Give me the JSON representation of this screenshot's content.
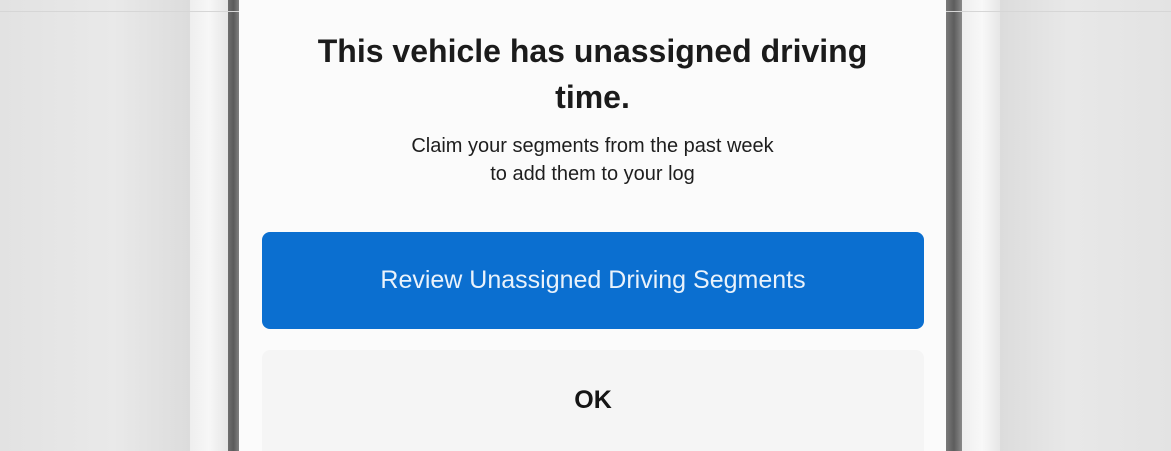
{
  "dialog": {
    "title_lines": [
      "This vehicle has unassigned driving",
      "time."
    ],
    "subtitle_lines": [
      "Claim your segments from the past week",
      "to add them to your log"
    ],
    "primary_button_label": "Review Unassigned Driving Segments",
    "secondary_button_label": "OK"
  },
  "colors": {
    "primary_button": "#0b6fd0",
    "dialog_background": "#fbfbfb",
    "secondary_button": "#f5f5f5",
    "frame_edge": "#5d5d5d"
  }
}
